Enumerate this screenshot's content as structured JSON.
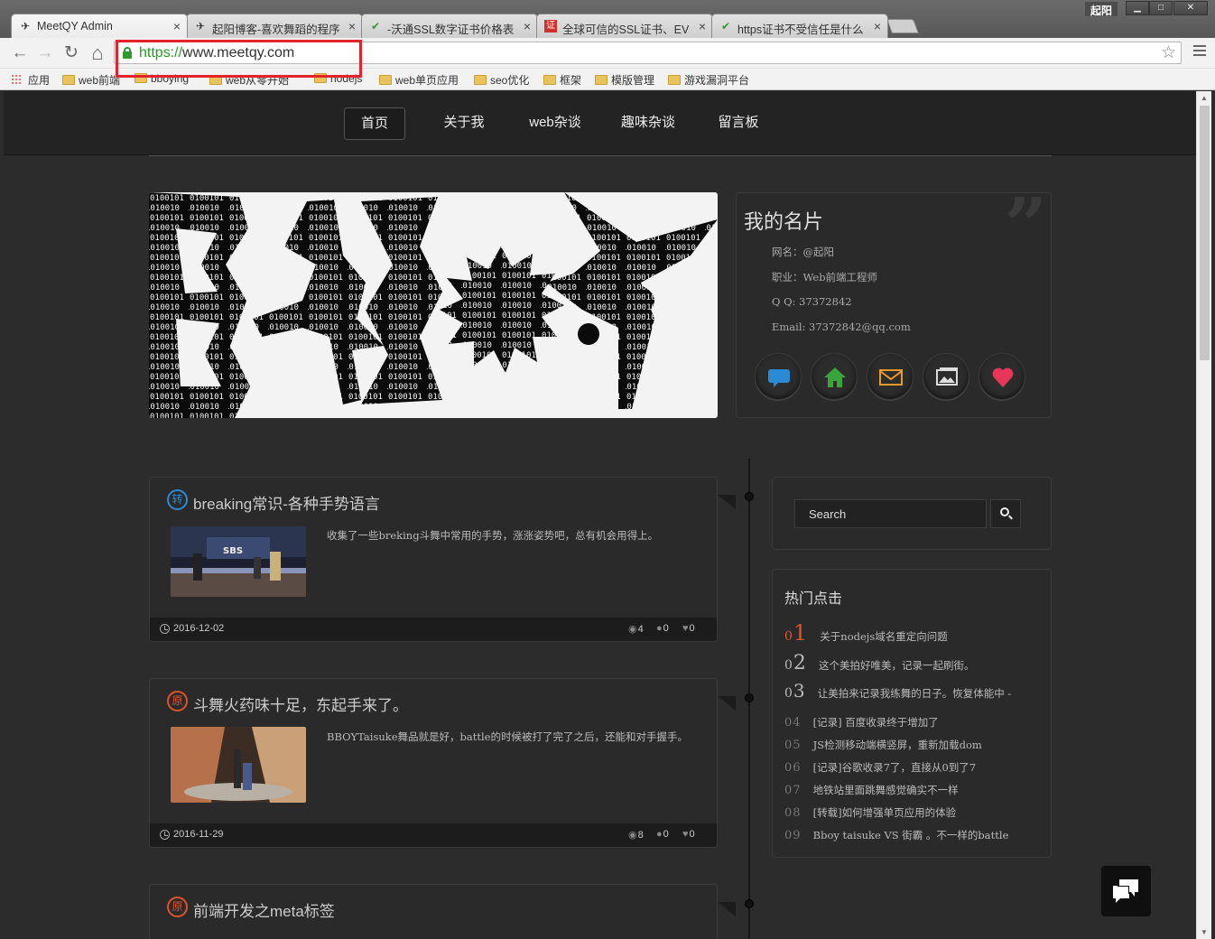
{
  "window": {
    "user": "起阳",
    "min_glyph": "▁",
    "max_glyph": "□",
    "close_glyph": "✕"
  },
  "tabs": [
    {
      "title": "MeetQY Admin",
      "icon": "bird-icon",
      "icon_color": "#444444",
      "close": "×"
    },
    {
      "title": "起阳博客-喜欢舞蹈的程序",
      "icon": "bird-icon",
      "icon_color": "#444444",
      "close": "×"
    },
    {
      "title": "-沃通SSL数字证书价格表",
      "icon": "check-circle-icon",
      "icon_color": "#2e9a2e",
      "close": "×"
    },
    {
      "title": "全球可信的SSL证书、EV",
      "icon": "red-square-icon",
      "icon_color": "#d0312d",
      "close": "×"
    },
    {
      "title": "https证书不受信任是什么",
      "icon": "check-circle-icon",
      "icon_color": "#2e9a2e",
      "close": "×"
    }
  ],
  "toolbar": {
    "back_glyph": "←",
    "forward_glyph": "→",
    "reload_glyph": "↻",
    "home_glyph": "⌂",
    "url_scheme": "https://",
    "url_host": "www.meetqy.com",
    "star_glyph": "☆"
  },
  "bookmarks": [
    {
      "label": "应用",
      "type": "apps"
    },
    {
      "label": "web前端",
      "type": "folder"
    },
    {
      "label": "bboying",
      "type": "folder"
    },
    {
      "label": "web从零开始",
      "type": "folder"
    },
    {
      "label": "nodejs",
      "type": "folder"
    },
    {
      "label": "web单页应用",
      "type": "folder"
    },
    {
      "label": "seo优化",
      "type": "folder"
    },
    {
      "label": "框架",
      "type": "folder"
    },
    {
      "label": "模版管理",
      "type": "folder"
    },
    {
      "label": "游戏漏洞平台",
      "type": "folder"
    }
  ],
  "nav": [
    {
      "label": "首页",
      "active": true
    },
    {
      "label": "关于我",
      "active": false
    },
    {
      "label": "web杂谈",
      "active": false
    },
    {
      "label": "趣味杂谈",
      "active": false
    },
    {
      "label": "留言板",
      "active": false
    }
  ],
  "card": {
    "title": "我的名片",
    "quote_glyph": "”",
    "lines": [
      "网名：@起阳",
      "职业：Web前端工程师",
      "Q Q: 37372842",
      "Email: 37372842@qq.com"
    ],
    "icons": [
      {
        "name": "chat-icon",
        "color": "#2a8ad4"
      },
      {
        "name": "home-icon",
        "color": "#3aa33a"
      },
      {
        "name": "mail-icon",
        "color": "#e89a2a"
      },
      {
        "name": "photo-icon",
        "color": "#dddddd"
      },
      {
        "name": "heart-icon",
        "color": "#e8365a"
      }
    ]
  },
  "posts": [
    {
      "badge": "转",
      "badge_type": "repost",
      "title": "breaking常识-各种手势语言",
      "excerpt": "收集了一些breking斗舞中常用的手势，涨涨姿势吧，总有机会用得上。",
      "date": "2016-12-02",
      "views": "4",
      "comments": "0",
      "likes": "0"
    },
    {
      "badge": "原",
      "badge_type": "original",
      "title": "斗舞火药味十足，东起手来了。",
      "excerpt": "BBOYTaisuke舞品就是好，battle的时候被打了完了之后，还能和对手握手。",
      "date": "2016-11-29",
      "views": "8",
      "comments": "0",
      "likes": "0"
    },
    {
      "badge": "原",
      "badge_type": "original",
      "title": "前端开发之meta标签"
    }
  ],
  "search": {
    "placeholder": "Search"
  },
  "hot": {
    "title": "热门点击",
    "items": [
      {
        "num_a": "0",
        "num_b": "1",
        "text": "关于nodejs域名重定向问题"
      },
      {
        "num_a": "0",
        "num_b": "2",
        "text": "这个美拍好唯美，记录一起刷街。"
      },
      {
        "num_a": "0",
        "num_b": "3",
        "text": "让美拍来记录我练舞的日子。恢复体能中 -"
      },
      {
        "num_a": "0",
        "num_b": "4",
        "text": "[记录] 百度收录终于增加了"
      },
      {
        "num_a": "0",
        "num_b": "5",
        "text": "JS检测移动端横竖屏，重新加载dom"
      },
      {
        "num_a": "0",
        "num_b": "6",
        "text": "[记录]谷歌收录7了，直接从0到了7"
      },
      {
        "num_a": "0",
        "num_b": "7",
        "text": "地铁站里面跳舞感觉确实不一样"
      },
      {
        "num_a": "0",
        "num_b": "8",
        "text": "[转载]如何增强单页应用的体验"
      },
      {
        "num_a": "0",
        "num_b": "9",
        "text": "Bboy taisuke VS 街霸 。不一样的battle"
      }
    ]
  },
  "colors": {
    "hot_accent": "#e0532a",
    "repost_badge": "#2a8ad4",
    "original_badge": "#e0532a",
    "url_scheme": "#239c23"
  }
}
